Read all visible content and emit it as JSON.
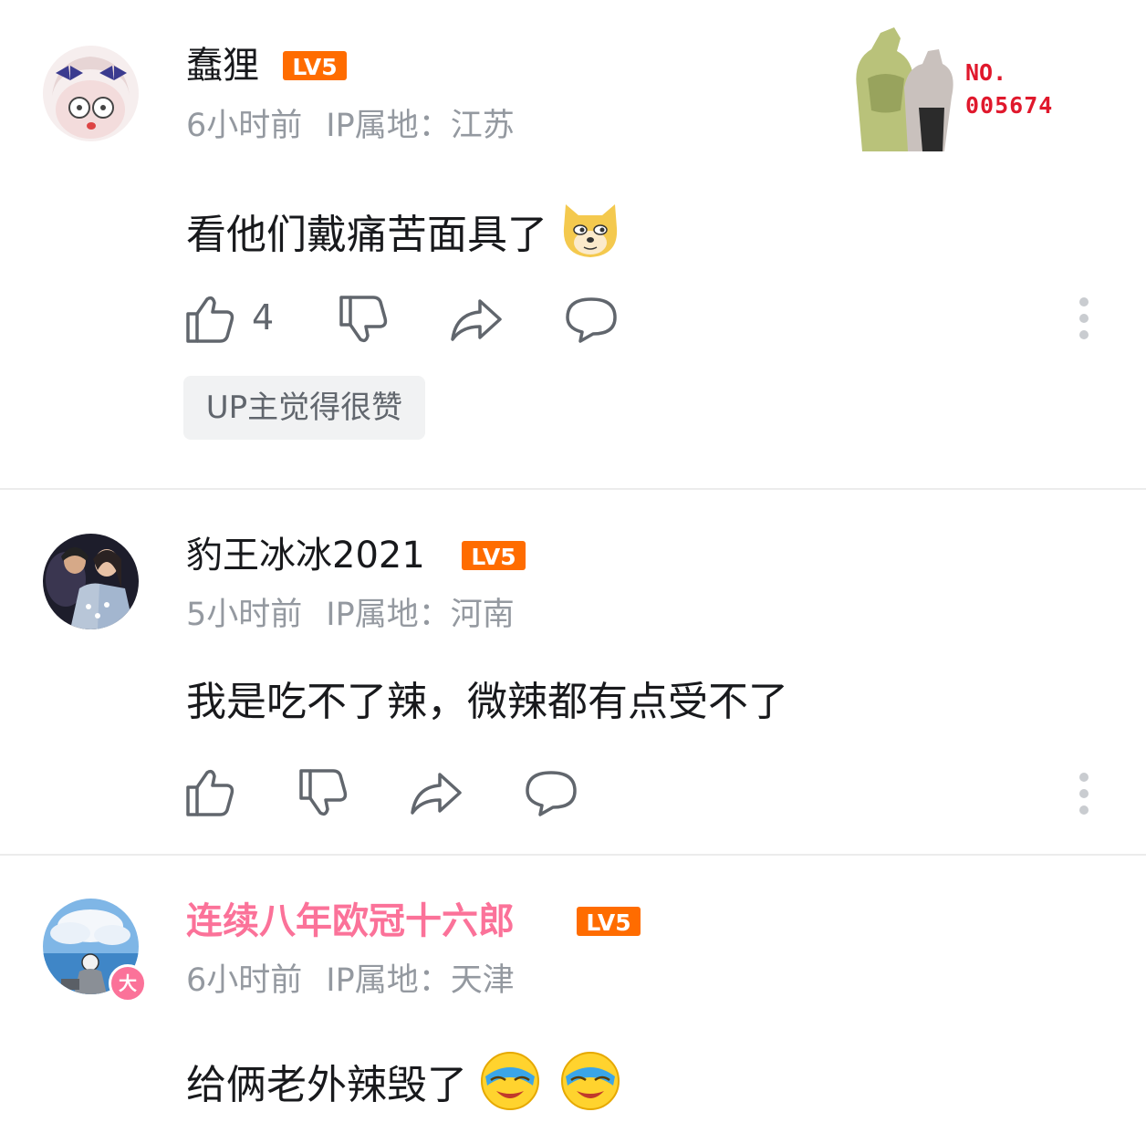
{
  "comments": [
    {
      "username": "蠢狸",
      "level": "LV5",
      "time": "6小时前",
      "ip": "IP属地：江苏",
      "content": "看他们戴痛苦面具了",
      "like_count": "4",
      "chip": "UP主觉得很赞",
      "badge": {
        "label": "NO.",
        "number": "005674"
      },
      "emojis": [
        "doge-emoji"
      ]
    },
    {
      "username": "豹王冰冰2021",
      "level": "LV5",
      "time": "5小时前",
      "ip": "IP属地：河南",
      "content": "我是吃不了辣，微辣都有点受不了",
      "like_count": ""
    },
    {
      "username": "连续八年欧冠十六郎",
      "level": "LV5",
      "time": "6小时前",
      "ip": "IP属地：天津",
      "content": "给俩老外辣毁了",
      "avatar_badge": "大",
      "emojis": [
        "laugh-cry-emoji",
        "laugh-cry-emoji"
      ]
    }
  ],
  "colors": {
    "text": "#18191c",
    "meta": "#9499a0",
    "vip_pink": "#fb7299",
    "level_orange": "#ff6c00",
    "divider": "#ececec",
    "badge_red": "#e0182c"
  },
  "icons": [
    "like-icon",
    "dislike-icon",
    "share-icon",
    "reply-icon",
    "more-icon"
  ]
}
